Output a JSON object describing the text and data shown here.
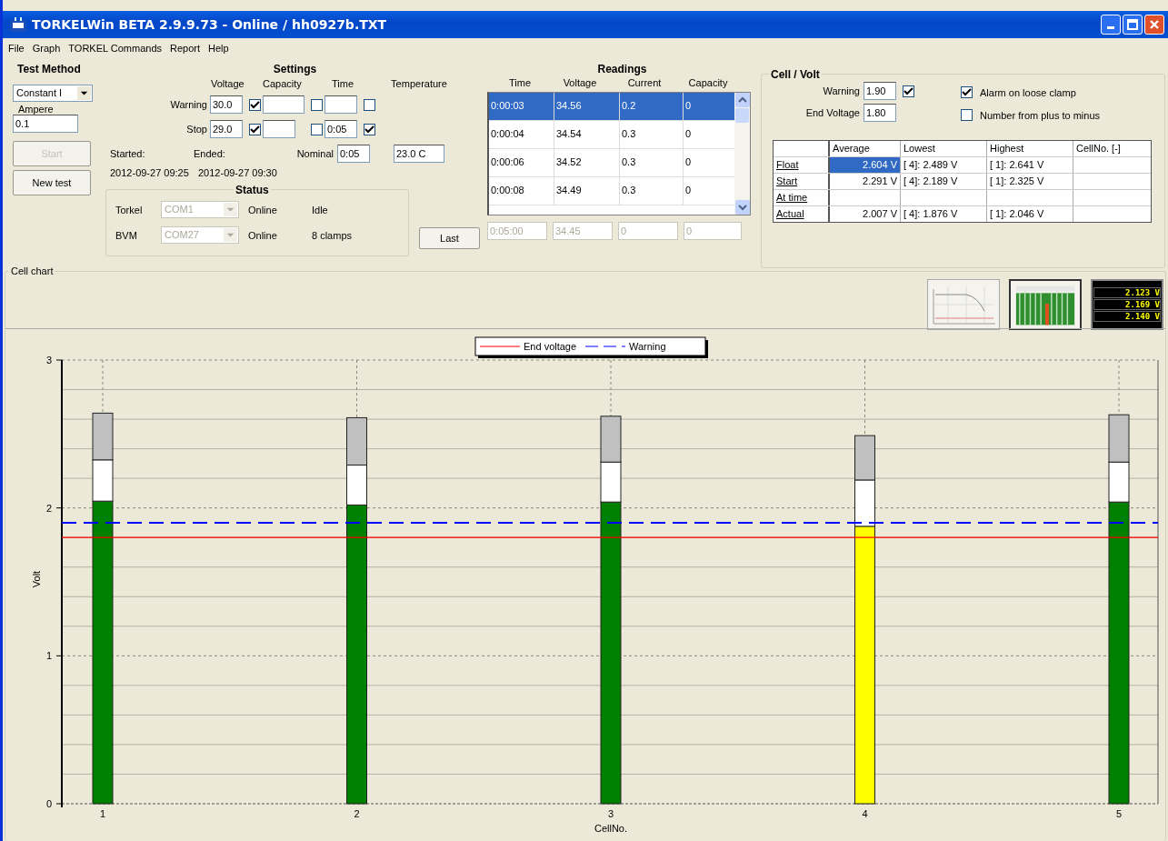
{
  "window": {
    "title": "TORKELWin BETA 2.9.9.73 - Online / hh0927b.TXT"
  },
  "menu": [
    "File",
    "Graph",
    "TORKEL Commands",
    "Report",
    "Help"
  ],
  "test_method": {
    "title": "Test Method",
    "method": "Constant I",
    "ampere_label": "Ampere",
    "ampere": "0.1",
    "buttons": [
      {
        "label": "Start",
        "disabled": true
      },
      {
        "label": "New test",
        "disabled": false
      }
    ]
  },
  "settings": {
    "title": "Settings",
    "columns": [
      "Voltage",
      "Capacity",
      "Time",
      "Temperature"
    ],
    "rows": [
      {
        "label": "Warning",
        "voltage": "30.0",
        "voltage_checked": true,
        "capacity_checked": false,
        "time_checked": false
      },
      {
        "label": "Stop",
        "voltage": "29.0",
        "voltage_checked": true,
        "capacity_checked": false,
        "time": "0:05",
        "time_checked": true
      }
    ],
    "started_label": "Started:",
    "ended_label": "Ended:",
    "nominal_label": "Nominal",
    "nominal": "0:05",
    "temperature": "23.0 C",
    "started": "2012-09-27 09:25",
    "ended": "2012-09-27 09:30"
  },
  "status": {
    "title": "Status",
    "rows": [
      {
        "device": "Torkel",
        "port": "COM1",
        "disabled": true,
        "state": "Online",
        "info": "Idle"
      },
      {
        "device": "BVM",
        "port": "COM27",
        "disabled": true,
        "state": "Online",
        "info": "8 clamps"
      }
    ]
  },
  "last_button": "Last",
  "readings": {
    "title": "Readings",
    "columns": [
      "Time",
      "Voltage",
      "Current",
      "Capacity"
    ],
    "rows": [
      {
        "cells": [
          "0:00:03",
          "34.56",
          "0.2",
          "0"
        ],
        "selected": true
      },
      {
        "cells": [
          "0:00:04",
          "34.54",
          "0.3",
          "0"
        ],
        "selected": false
      },
      {
        "cells": [
          "0:00:06",
          "34.52",
          "0.3",
          "0"
        ],
        "selected": false
      },
      {
        "cells": [
          "0:00:08",
          "34.49",
          "0.3",
          "0"
        ],
        "selected": false
      }
    ],
    "last": [
      "0:05:00",
      "34.45",
      "0",
      "0"
    ]
  },
  "cell_volt": {
    "title": "Cell / Volt",
    "warning_label": "Warning",
    "warning": "1.90",
    "warning_checked": true,
    "end_label": "End Voltage",
    "end": "1.80",
    "options": [
      {
        "label": "Alarm on loose clamp",
        "checked": true
      },
      {
        "label": "Number from plus to minus",
        "checked": false
      }
    ],
    "table": {
      "columns": [
        "Average",
        "Lowest",
        "Highest",
        "CellNo. [-]"
      ],
      "rows": [
        {
          "label": "Float",
          "cells": [
            {
              "text": "2.604 V",
              "selected": true
            },
            {
              "text": "[ 4]: 2.489 V",
              "selected": false
            },
            {
              "text": "[ 1]: 2.641 V",
              "selected": false
            },
            {
              "selected": false
            }
          ]
        },
        {
          "label": "Start",
          "cells": [
            {
              "text": "2.291 V",
              "selected": false
            },
            {
              "text": "[ 4]: 2.189 V",
              "selected": false
            },
            {
              "text": "[ 1]: 2.325 V",
              "selected": false
            },
            {
              "selected": false
            }
          ]
        },
        {
          "label": "At time",
          "cells": [
            {
              "selected": false
            },
            {
              "selected": false
            },
            {
              "selected": false
            },
            {
              "selected": false
            }
          ]
        },
        {
          "label": "Actual",
          "cells": [
            {
              "text": "2.007 V",
              "selected": false
            },
            {
              "text": "[ 4]: 1.876 V",
              "selected": false
            },
            {
              "text": "[ 1]: 2.046 V",
              "selected": false
            },
            {
              "selected": false
            }
          ]
        }
      ]
    }
  },
  "cell_chart": {
    "title": "Cell chart",
    "views": [
      {
        "kind": "line",
        "selected": false
      },
      {
        "kind": "bar",
        "selected": true
      },
      {
        "kind": "digital",
        "selected": false,
        "readouts": [
          "2.123 V",
          "2.169 V",
          "2.140 V"
        ]
      }
    ],
    "chart_data": {
      "type": "bar",
      "xlabel": "CellNo.",
      "ylabel": "Volt",
      "categories": [
        "1",
        "2",
        "3",
        "4",
        "5"
      ],
      "stacked": true,
      "grid": true,
      "legend": "upper center",
      "ylim": [
        0,
        3
      ],
      "yticks": [
        0,
        1,
        2,
        3
      ],
      "series": [
        {
          "color": "#008000",
          "values": [
            2.046,
            2.02,
            2.04,
            null,
            2.04
          ]
        },
        {
          "color": "#ffff00",
          "values": [
            null,
            null,
            null,
            1.876,
            null
          ]
        },
        {
          "color": "#ffffff",
          "values": [
            0.279,
            0.27,
            0.27,
            0.313,
            0.27
          ]
        },
        {
          "color": "#c0c0c0",
          "values": [
            0.316,
            0.32,
            0.31,
            0.3,
            0.32
          ]
        }
      ],
      "ref_lines": [
        {
          "axis": "y",
          "value": 1.8,
          "label": "End voltage",
          "color": "#ff0000"
        },
        {
          "axis": "y",
          "value": 1.9,
          "label": "Warning",
          "color": "#0000ff"
        }
      ]
    }
  }
}
